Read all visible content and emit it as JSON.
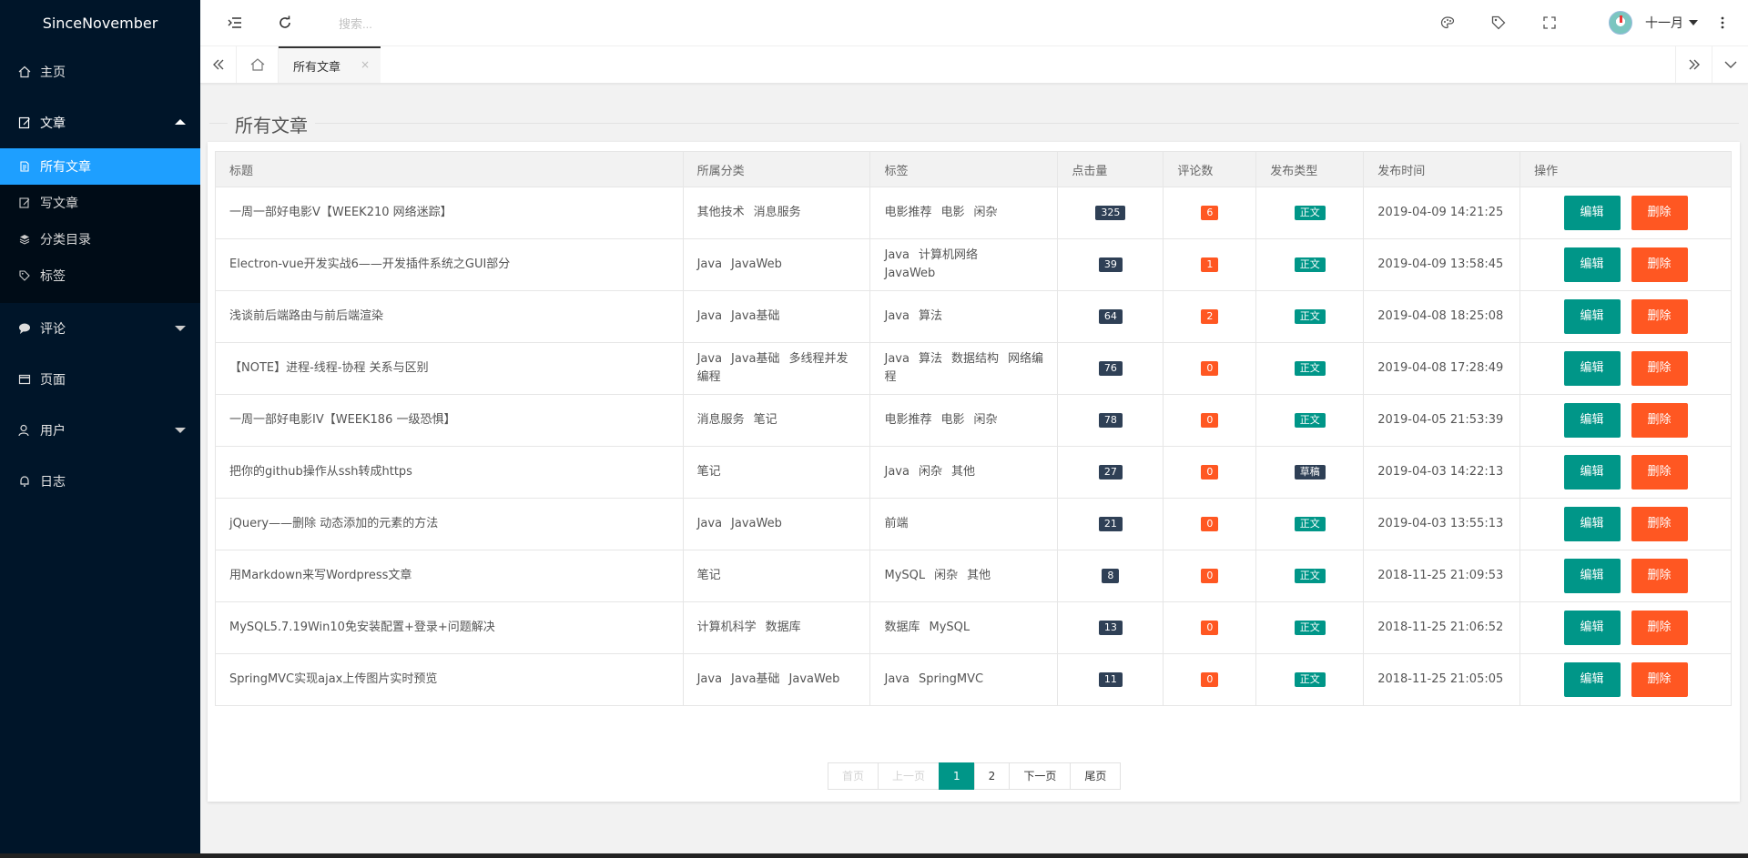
{
  "brand": "SinceNovember",
  "sidebar": {
    "home": "主页",
    "article": "文章",
    "article_sub": [
      "所有文章",
      "写文章",
      "分类目录",
      "标签"
    ],
    "comment": "评论",
    "page": "页面",
    "user": "用户",
    "log": "日志"
  },
  "header": {
    "search_placeholder": "搜索...",
    "username": "十一月"
  },
  "tabs": {
    "active": "所有文章",
    "close": "×"
  },
  "content": {
    "title": "所有文章"
  },
  "table": {
    "columns": [
      "标题",
      "所属分类",
      "标签",
      "点击量",
      "评论数",
      "发布类型",
      "发布时间",
      "操作"
    ],
    "edit_label": "编辑",
    "delete_label": "删除",
    "rows": [
      {
        "title": "一周一部好电影V【WEEK210 网络迷踪】",
        "cats": [
          "其他技术",
          "消息服务"
        ],
        "tags": [
          "电影推荐",
          "电影",
          "闲杂"
        ],
        "views": "325",
        "comments": "6",
        "type": "正文",
        "time": "2019-04-09 14:21:25"
      },
      {
        "title": "Electron-vue开发实战6——开发插件系统之GUI部分",
        "cats": [
          "Java",
          "JavaWeb"
        ],
        "tags": [
          "Java",
          "计算机网络",
          "JavaWeb"
        ],
        "views": "39",
        "comments": "1",
        "type": "正文",
        "time": "2019-04-09 13:58:45"
      },
      {
        "title": "浅谈前后端路由与前后端渲染",
        "cats": [
          "Java",
          "Java基础"
        ],
        "tags": [
          "Java",
          "算法"
        ],
        "views": "64",
        "comments": "2",
        "type": "正文",
        "time": "2019-04-08 18:25:08"
      },
      {
        "title": "【NOTE】进程-线程-协程 关系与区别",
        "cats": [
          "Java",
          "Java基础",
          "多线程并发编程"
        ],
        "tags": [
          "Java",
          "算法",
          "数据结构",
          "网络编程"
        ],
        "views": "76",
        "comments": "0",
        "type": "正文",
        "time": "2019-04-08 17:28:49"
      },
      {
        "title": "一周一部好电影IV【WEEK186 一级恐惧】",
        "cats": [
          "消息服务",
          "笔记"
        ],
        "tags": [
          "电影推荐",
          "电影",
          "闲杂"
        ],
        "views": "78",
        "comments": "0",
        "type": "正文",
        "time": "2019-04-05 21:53:39"
      },
      {
        "title": "把你的github操作从ssh转成https",
        "cats": [
          "笔记"
        ],
        "tags": [
          "Java",
          "闲杂",
          "其他"
        ],
        "views": "27",
        "comments": "0",
        "type": "草稿",
        "time": "2019-04-03 14:22:13"
      },
      {
        "title": "jQuery——删除 动态添加的元素的方法",
        "cats": [
          "Java",
          "JavaWeb"
        ],
        "tags": [
          "前端"
        ],
        "views": "21",
        "comments": "0",
        "type": "正文",
        "time": "2019-04-03 13:55:13"
      },
      {
        "title": "用Markdown来写Wordpress文章",
        "cats": [
          "笔记"
        ],
        "tags": [
          "MySQL",
          "闲杂",
          "其他"
        ],
        "views": "8",
        "comments": "0",
        "type": "正文",
        "time": "2018-11-25 21:09:53"
      },
      {
        "title": "MySQL5.7.19Win10免安装配置+登录+问题解决",
        "cats": [
          "计算机科学",
          "数据库"
        ],
        "tags": [
          "数据库",
          "MySQL"
        ],
        "views": "13",
        "comments": "0",
        "type": "正文",
        "time": "2018-11-25 21:06:52"
      },
      {
        "title": "SpringMVC实现ajax上传图片实时预览",
        "cats": [
          "Java",
          "Java基础",
          "JavaWeb"
        ],
        "tags": [
          "Java",
          "SpringMVC"
        ],
        "views": "11",
        "comments": "0",
        "type": "正文",
        "time": "2018-11-25 21:05:05"
      }
    ]
  },
  "pager": {
    "first": "首页",
    "prev": "上一页",
    "pages": [
      "1",
      "2"
    ],
    "next": "下一页",
    "last": "尾页"
  },
  "colors": {
    "sidebar_bg": "#001529",
    "active_blue": "#1e9fff",
    "green": "#009688",
    "orange": "#ff5722",
    "dark_badge": "#2f4056"
  }
}
